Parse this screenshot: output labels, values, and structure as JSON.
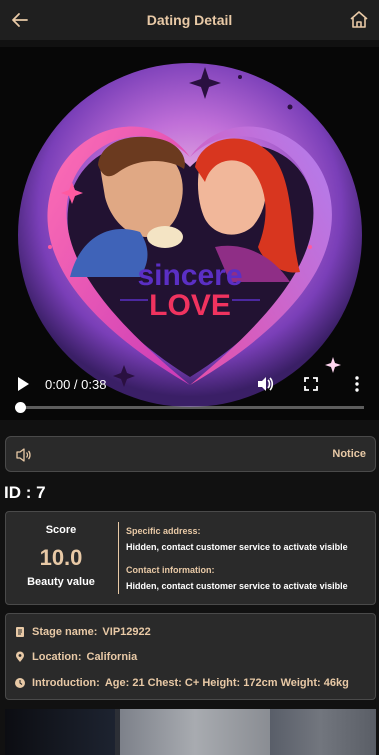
{
  "header": {
    "title": "Dating Detail",
    "accent_color": "#e8c9a6",
    "back_icon": "arrow-left-icon",
    "home_icon": "home-icon"
  },
  "video": {
    "poster_text_top": "sincere",
    "poster_text_bottom": "LOVE",
    "time": "0:00 / 0:38",
    "progress": 0,
    "play_icon": "play-icon",
    "volume_icon": "volume-icon",
    "fullscreen_icon": "fullscreen-icon",
    "more_icon": "more-vertical-icon"
  },
  "notice": {
    "label": "Notice",
    "icon": "speaker-icon"
  },
  "profile": {
    "id_line": "ID : 7"
  },
  "score": {
    "label": "Score",
    "value": "10.0",
    "beauty_label": "Beauty value",
    "address_key": "Specific address:",
    "address_value": "Hidden, contact customer service to activate visible",
    "contact_key": "Contact information:",
    "contact_value": "Hidden, contact customer service to activate visible"
  },
  "details": {
    "stage_key": "Stage name:",
    "stage_value": "VIP12922",
    "location_key": "Location:",
    "location_value": "California",
    "intro_key": "Introduction:",
    "intro_value": "Age: 21 Chest: C+ Height: 172cm Weight: 46kg"
  }
}
